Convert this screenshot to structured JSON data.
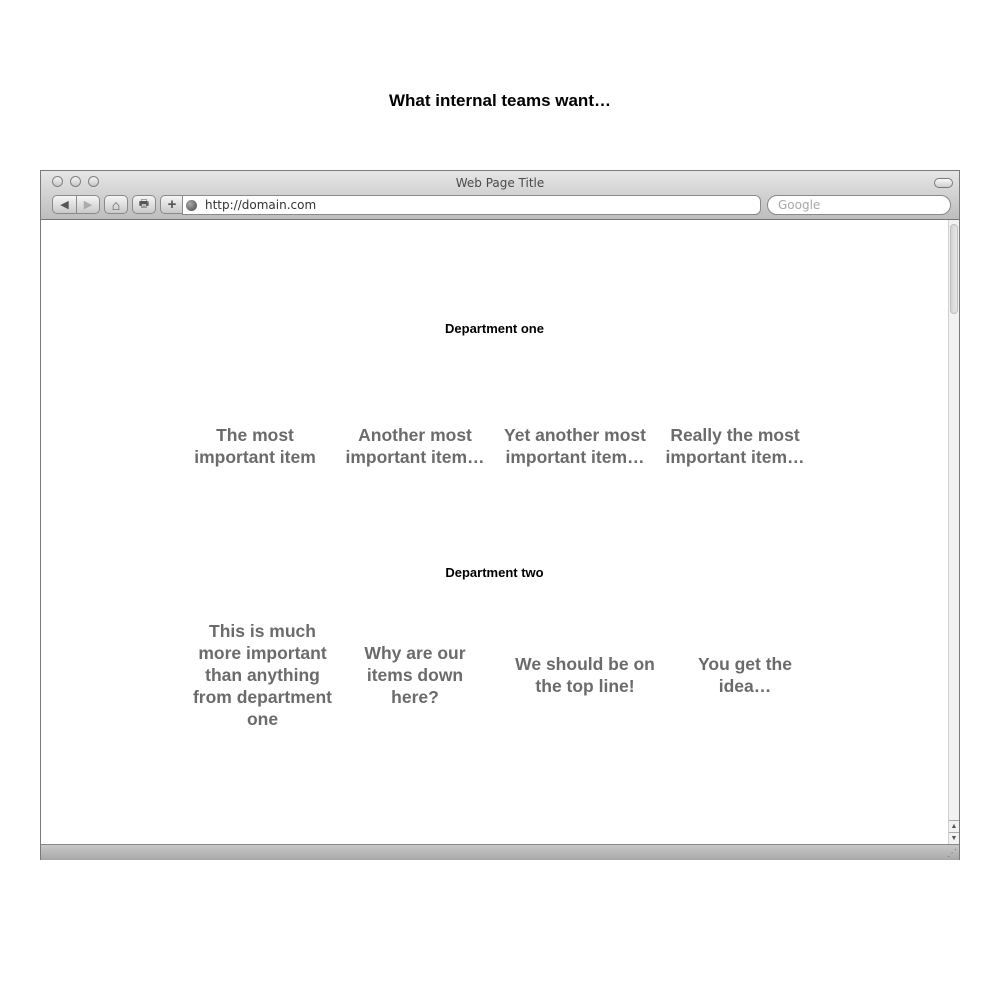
{
  "page": {
    "heading": "What internal teams want…"
  },
  "browser": {
    "window_title": "Web Page Title",
    "url": "http://domain.com",
    "search_placeholder": "Google",
    "buttons": {
      "back": "◀",
      "forward": "▶",
      "home": "⌂",
      "print": "🖶",
      "add": "+"
    },
    "scroll": {
      "up": "▲",
      "down": "▼"
    }
  },
  "content": {
    "departments": [
      {
        "title": "Department one",
        "items": [
          "The most important item",
          "Another most important item…",
          "Yet another most important item…",
          "Really the most important item…"
        ]
      },
      {
        "title": "Department two",
        "items": [
          "This is much more important than anything from department one",
          "Why are our items down here?",
          "We should be on the top line!",
          "You get the idea…"
        ]
      }
    ]
  }
}
